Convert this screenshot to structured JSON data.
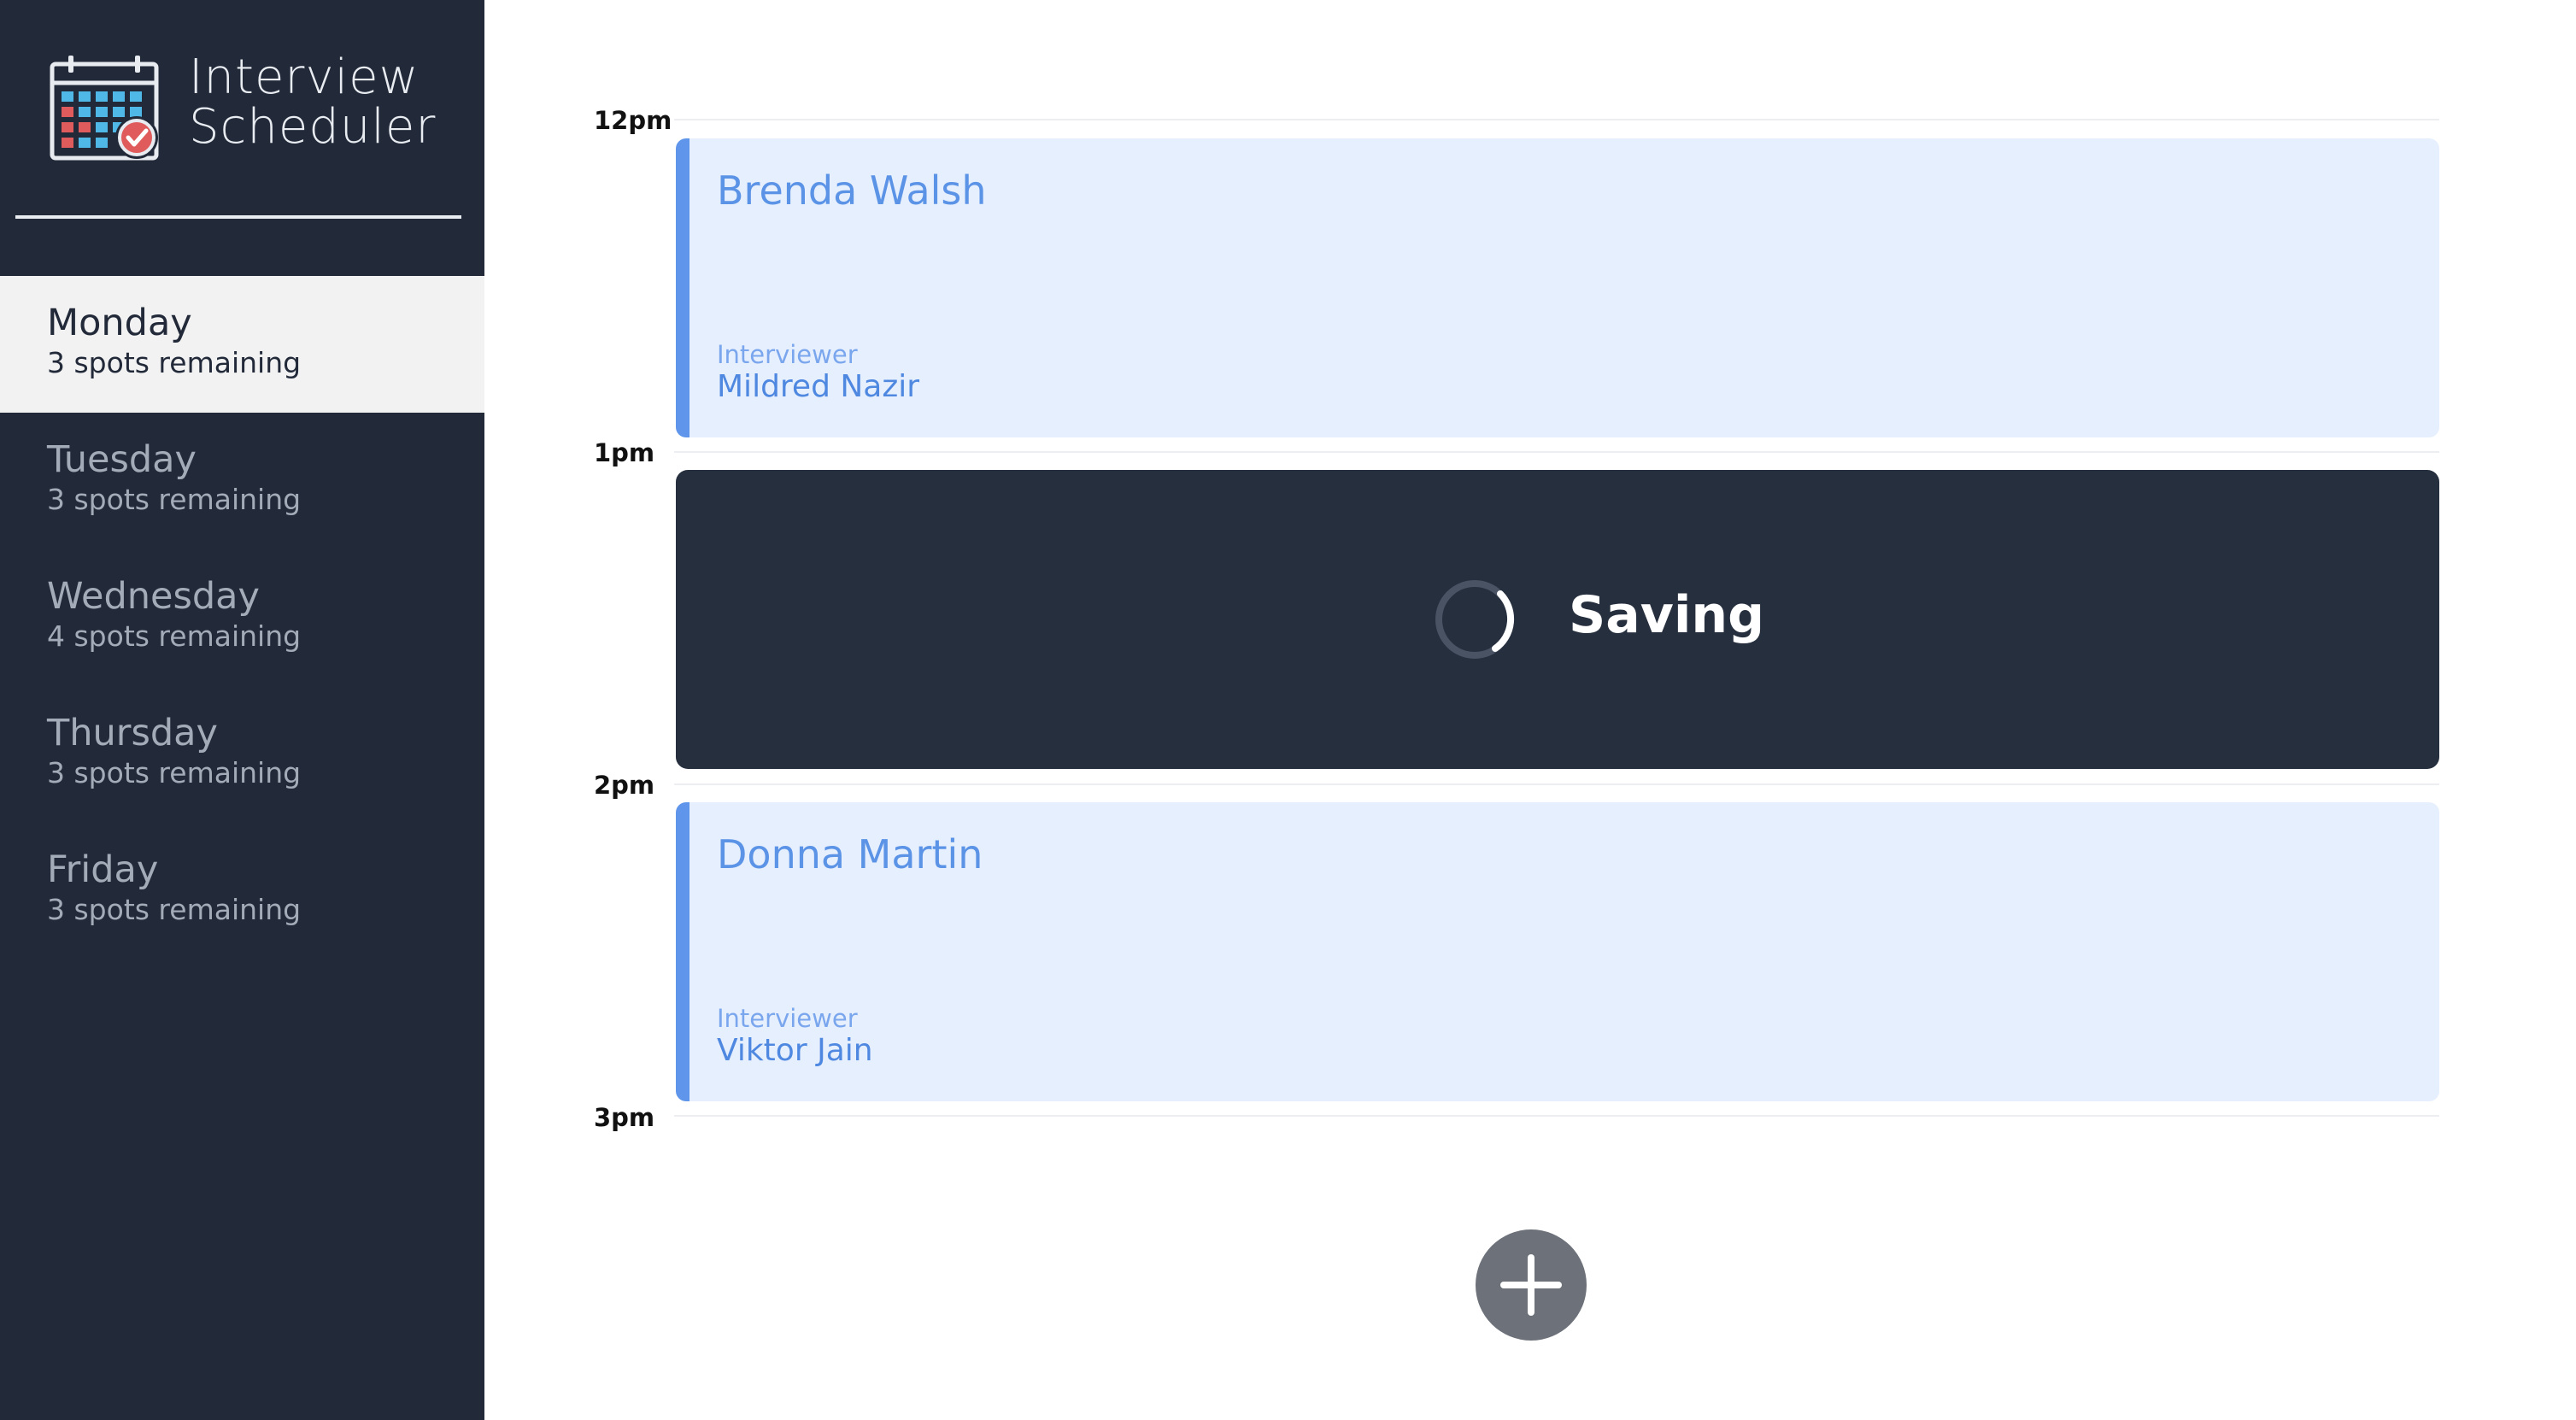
{
  "app": {
    "title_line1": "Interview",
    "title_line2": "Scheduler"
  },
  "days": [
    {
      "name": "Monday",
      "spots": "3 spots remaining",
      "selected": true
    },
    {
      "name": "Tuesday",
      "spots": "3 spots remaining",
      "selected": false
    },
    {
      "name": "Wednesday",
      "spots": "4 spots remaining",
      "selected": false
    },
    {
      "name": "Thursday",
      "spots": "3 spots remaining",
      "selected": false
    },
    {
      "name": "Friday",
      "spots": "3 spots remaining",
      "selected": false
    }
  ],
  "schedule": {
    "times": [
      "12pm",
      "1pm",
      "2pm",
      "3pm"
    ],
    "appointments": [
      {
        "student": "Brenda Walsh",
        "interviewer_label": "Interviewer",
        "interviewer": "Mildred Nazir"
      },
      {
        "status": "Saving"
      },
      {
        "student": "Donna Martin",
        "interviewer_label": "Interviewer",
        "interviewer": "Viktor Jain"
      }
    ]
  },
  "icons": {
    "logo": "calendar-check-icon",
    "spinner": "spinner-icon",
    "add": "plus-icon"
  },
  "colors": {
    "sidebar": "#222a3a",
    "accent": "#5f95ea",
    "appointment_bg": "#e6effd",
    "saving_bg": "#262f3e",
    "add_button": "#6d7179"
  }
}
